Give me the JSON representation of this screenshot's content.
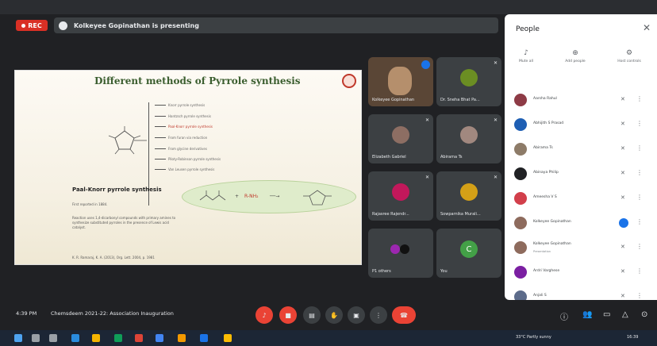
{
  "recording": {
    "label": "REC"
  },
  "presenting_banner": "Kolkeyee Gopinathan is presenting",
  "slide": {
    "title": "Different methods of Pyrrole synthesis",
    "methods": [
      "Knorr pyrrole synthesis",
      "Hantzsch pyrrole synthesis",
      "Paal-Knorr pyrrole synthesis",
      "From furan via reduction",
      "From glycine derivatives",
      "Piloty-Robinson pyrrole synthesis",
      "Van Leusen pyrrole synthesis"
    ],
    "subheading": "Paal-Knorr pyrrole synthesis",
    "bullets": [
      "First reported in 1884.",
      "Reaction uses 1,4-dicarbonyl compounds with primary amines to synthesize substituted pyrroles in the presence of Lewis acid catalyst."
    ],
    "reference": "K. R. Ramaraj, K. A. (2013), Org. Lett. 2004, p. 1981"
  },
  "tiles": [
    {
      "name": "Kolkeyee Gopinathan",
      "type": "video"
    },
    {
      "name": "Dr. Sneha Bhat Pa...",
      "type": "avatar",
      "color": "#6b8e23"
    },
    {
      "name": "Elizabeth Gabriel",
      "type": "avatar",
      "color": "#8d6e63"
    },
    {
      "name": "Abirama Ts",
      "type": "avatar",
      "color": "#a1887f"
    },
    {
      "name": "Rajasree Rajendr...",
      "type": "avatar",
      "color": "#c2185b"
    },
    {
      "name": "Sowparnika Murali...",
      "type": "avatar",
      "color": "#d4a017"
    },
    {
      "name": "P1 others",
      "type": "others",
      "color": "#9c27b0"
    },
    {
      "name": "You",
      "type": "letter",
      "letter": "C",
      "color": "#43a047"
    }
  ],
  "panel": {
    "title": "People",
    "actions": [
      {
        "icon": "mute-all-icon",
        "label": "Mute all"
      },
      {
        "icon": "add-people-icon",
        "label": "Add people"
      },
      {
        "icon": "host-controls-icon",
        "label": "Host controls"
      }
    ],
    "people": [
      {
        "name": "Aarsha Rahul",
        "sub": "",
        "color": "#8e3b46"
      },
      {
        "name": "Abhijith S Prasad",
        "sub": "",
        "color": "#1e5fb4"
      },
      {
        "name": "Abirama Ts",
        "sub": "",
        "color": "#8d7b68"
      },
      {
        "name": "Abinaya Philip",
        "sub": "",
        "color": "#202124"
      },
      {
        "name": "Ameesha V S",
        "sub": "",
        "color": "#d23f4b"
      },
      {
        "name": "Kolkeyee Gopinathan",
        "sub": "",
        "color": "#8e6b5d",
        "speaking": true
      },
      {
        "name": "Kolkeyee Gopinathan",
        "sub": "Presentation",
        "color": "#8e6b5d"
      },
      {
        "name": "Ardri Varghese",
        "sub": "",
        "color": "#7b1fa2"
      },
      {
        "name": "Anjali S",
        "sub": "",
        "color": "#5c6b8a"
      }
    ]
  },
  "meetbar": {
    "time": "4:39 PM",
    "meeting_name": "Chemsdeem 2021-22: Association Inauguration"
  },
  "taskbar": {
    "weather": "33°C  Partly sunny",
    "clock": "16:39"
  },
  "colors": {
    "accent": "#1a73e8",
    "end_call": "#ea4335",
    "slide_title": "#3a5d2e"
  }
}
